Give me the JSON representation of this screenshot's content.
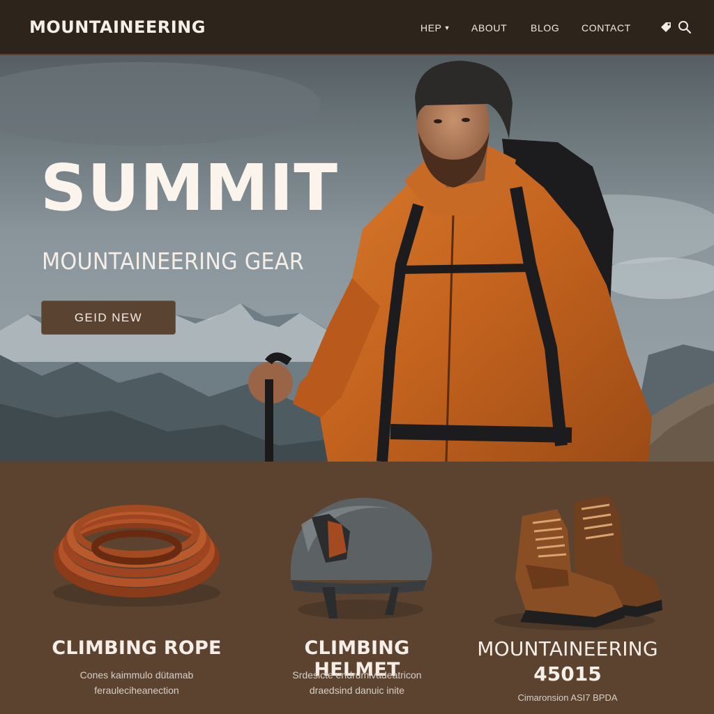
{
  "header": {
    "brand": "MOUNTAINEERING",
    "nav": [
      {
        "label": "HEP"
      },
      {
        "label": "ABOUT"
      },
      {
        "label": "BLOG"
      },
      {
        "label": "CONTACT"
      }
    ],
    "icons": [
      "tag-icon",
      "search-icon"
    ]
  },
  "hero": {
    "title": "SUMMIT",
    "subtitle": "MOUNTAINEERING GEAR",
    "cta_label": "GEID NEW"
  },
  "products": [
    {
      "name": "CLIMBING ROPE",
      "desc_line1": "Cones kaimmulo dütamab",
      "desc_line2": "ferauleciheanection",
      "icon": "rope-icon"
    },
    {
      "name": "CLIMBING HELMET",
      "desc_line1": "Srdesicte endrumivadeatricon",
      "desc_line2": "draedsind danuic inite",
      "icon": "helmet-icon"
    },
    {
      "name": "MOUNTAINEERING",
      "price": "45015",
      "desc_line1": "Cimaronsion  ASI7 BPDA",
      "icon": "boots-icon"
    }
  ],
  "colors": {
    "header_bg": "#2d241c",
    "accent_brown": "#5b4331",
    "jacket_orange": "#c96a23",
    "products_bg": "#5b4330"
  }
}
